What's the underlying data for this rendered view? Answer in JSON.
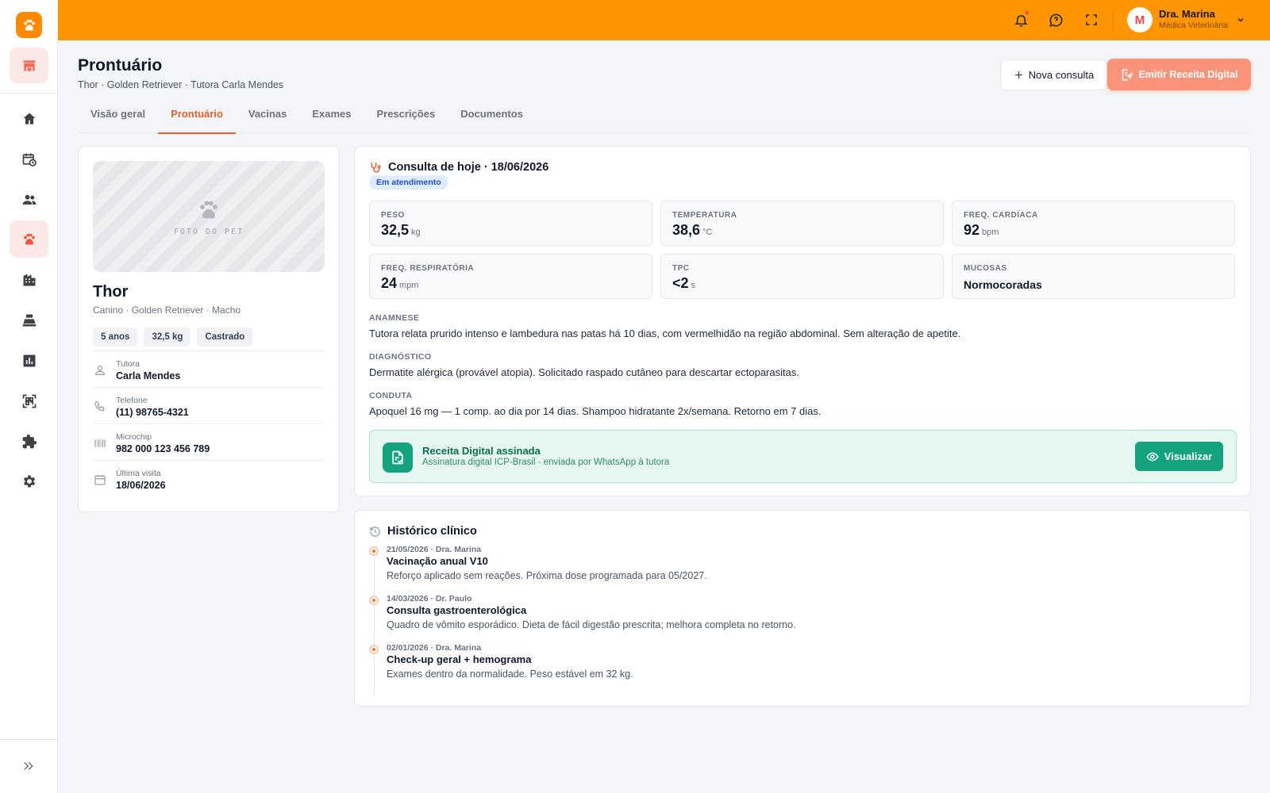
{
  "topbar": {
    "user": {
      "initial": "M",
      "name": "Dra. Marina",
      "role": "Médica Veterinária"
    }
  },
  "header": {
    "title": "Prontuário",
    "subtitle": "Thor · Golden Retriever · Tutora Carla Mendes",
    "nova_consulta": "Nova consulta",
    "emitir_receita": "Emitir Receita Digital"
  },
  "tabs": [
    {
      "label": "Visão geral"
    },
    {
      "label": "Prontuário"
    },
    {
      "label": "Vacinas"
    },
    {
      "label": "Exames"
    },
    {
      "label": "Prescrições"
    },
    {
      "label": "Documentos"
    }
  ],
  "pet": {
    "photo_label": "FOTO DO PET",
    "name": "Thor",
    "meta": "Canino · Golden Retriever · Macho",
    "chips": [
      "5 anos",
      "32,5 kg",
      "Castrado"
    ],
    "info": [
      {
        "label": "Tutora",
        "value": "Carla Mendes"
      },
      {
        "label": "Telefone",
        "value": "(11) 98765-4321"
      },
      {
        "label": "Microchip",
        "value": "982 000 123 456 789"
      },
      {
        "label": "Última visita",
        "value": "18/06/2026"
      }
    ]
  },
  "consulta": {
    "title": "Consulta de hoje · 18/06/2026",
    "status": "Em atendimento",
    "vitals": [
      {
        "label": "PESO",
        "value": "32,5",
        "unit": "kg"
      },
      {
        "label": "TEMPERATURA",
        "value": "38,6",
        "unit": "°C"
      },
      {
        "label": "FREQ. CARDÍACA",
        "value": "92",
        "unit": "bpm"
      },
      {
        "label": "FREQ. RESPIRATÓRIA",
        "value": "24",
        "unit": "mpm"
      },
      {
        "label": "TPC",
        "value": "<2",
        "unit": "s"
      },
      {
        "label": "MUCOSAS",
        "value": "Normocoradas",
        "unit": ""
      }
    ],
    "notes": [
      {
        "label": "ANAMNESE",
        "text": "Tutora relata prurido intenso e lambedura nas patas há 10 dias, com vermelhidão na região abdominal. Sem alteração de apetite."
      },
      {
        "label": "DIAGNÓSTICO",
        "text": "Dermatite alérgica (provável atopia). Solicitado raspado cutâneo para descartar ectoparasitas."
      },
      {
        "label": "CONDUTA",
        "text": "Apoquel 16 mg — 1 comp. ao dia por 14 dias. Shampoo hidratante 2x/semana. Retorno em 7 dias."
      }
    ],
    "receita": {
      "title": "Receita Digital assinada",
      "subtitle": "Assinatura digital ICP-Brasil · enviada por WhatsApp à tutora",
      "button": "Visualizar"
    }
  },
  "historico": {
    "title": "Histórico clínico",
    "items": [
      {
        "meta": "21/05/2026 · Dra. Marina",
        "title": "Vacinação anual V10",
        "desc": "Reforço aplicado sem reações. Próxima dose programada para 05/2027."
      },
      {
        "meta": "14/03/2026 · Dr. Paulo",
        "title": "Consulta gastroenterológica",
        "desc": "Quadro de vômito esporádico. Dieta de fácil digestão prescrita; melhora completa no retorno."
      },
      {
        "meta": "02/01/2026 · Dra. Marina",
        "title": "Check-up geral + hemograma",
        "desc": "Exames dentro da normalidade. Peso estável em 32 kg."
      }
    ]
  },
  "colors": {
    "topbar": "#ff9500",
    "accent": "#e85d2a",
    "success": "#15a37f",
    "badge_bg": "#e0ecff"
  },
  "icons": {
    "sidebar": [
      "paw-logo-icon",
      "store-icon",
      "home-icon",
      "calendar-clock-icon",
      "people-icon",
      "paw-icon",
      "building-icon",
      "cash-register-icon",
      "chart-icon",
      "qr-code-icon",
      "puzzle-icon",
      "gear-icon",
      "double-chevron-right-icon"
    ],
    "topbar": [
      "bell-icon",
      "chat-help-icon",
      "fullscreen-icon",
      "chevron-down-icon"
    ]
  }
}
